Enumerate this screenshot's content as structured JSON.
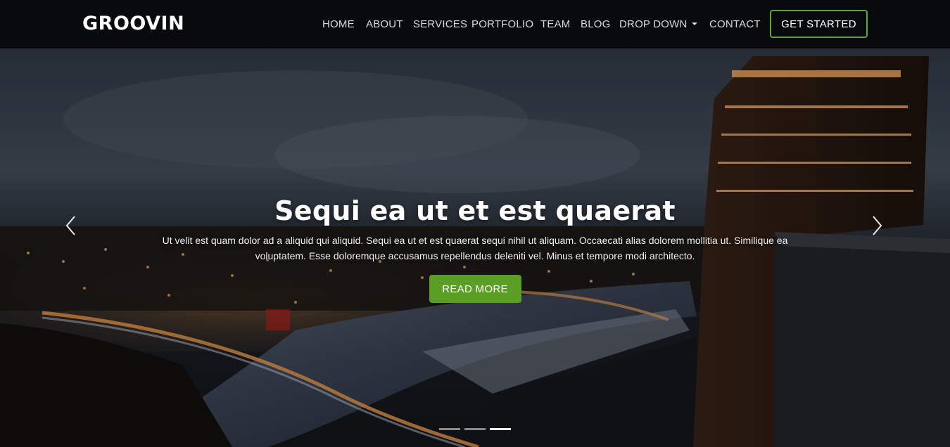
{
  "header": {
    "logo": "GROOVIN",
    "nav": [
      {
        "label": "HOME"
      },
      {
        "label": "ABOUT"
      },
      {
        "label": "SERVICES"
      },
      {
        "label": "PORTFOLIO"
      },
      {
        "label": "TEAM"
      },
      {
        "label": "BLOG"
      },
      {
        "label": "DROP DOWN",
        "has_dropdown": true
      },
      {
        "label": "CONTACT"
      }
    ],
    "cta_label": "GET STARTED"
  },
  "hero": {
    "title": "Sequi ea ut et est quaerat",
    "description": "Ut velit est quam dolor ad a aliquid qui aliquid. Sequi ea ut et est quaerat sequi nihil ut aliquam. Occaecati alias dolorem mollitia ut. Similique ea voluptatem. Esse doloremque accusamus repellendus deleniti vel. Minus et tempore modi architecto.",
    "button_label": "READ MORE",
    "prev_icon": "chevron-left-icon",
    "next_icon": "chevron-right-icon",
    "slides_count": 3,
    "active_slide": 3
  },
  "colors": {
    "accent": "#5fa82b",
    "header_bg": "#06080b",
    "button_bg": "#5a9e25"
  }
}
